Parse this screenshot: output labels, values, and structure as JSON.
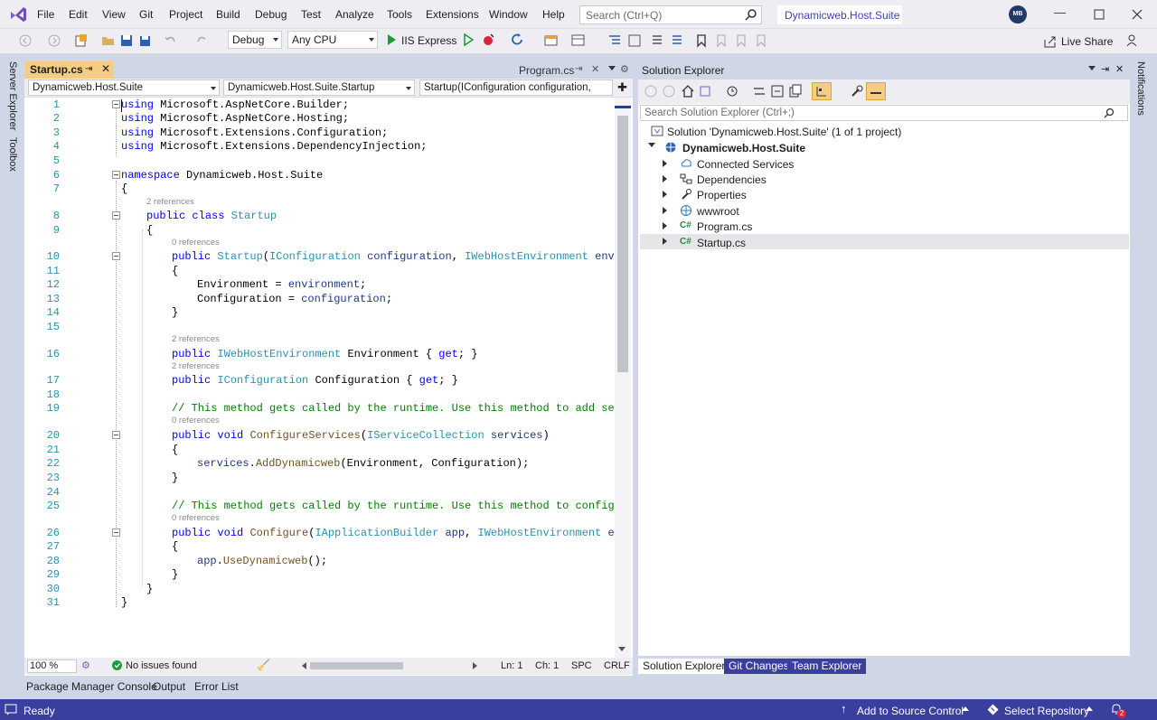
{
  "menu": [
    "File",
    "Edit",
    "View",
    "Git",
    "Project",
    "Build",
    "Debug",
    "Test",
    "Analyze",
    "Tools",
    "Extensions",
    "Window",
    "Help"
  ],
  "search": {
    "placeholder": "Search (Ctrl+Q)"
  },
  "solution_name": "Dynamicweb.Host.Suite",
  "user_initials": "MB",
  "toolbar": {
    "config": "Debug",
    "platform": "Any CPU",
    "run_target": "IIS Express",
    "live_share": "Live Share"
  },
  "side_rails": {
    "server_explorer": "Server Explorer",
    "toolbox": "Toolbox",
    "notifications": "Notifications"
  },
  "editor": {
    "active_tab": "Startup.cs",
    "other_tab": "Program.cs",
    "nav": {
      "project": "Dynamicweb.Host.Suite",
      "type": "Dynamicweb.Host.Suite.Startup",
      "member": "Startup(IConfiguration configuration,"
    },
    "lines": [
      {
        "n": "1",
        "t": "using Microsoft.AspNetCore.Builder;"
      },
      {
        "n": "2",
        "t": "using Microsoft.AspNetCore.Hosting;"
      },
      {
        "n": "3",
        "t": "using Microsoft.Extensions.Configuration;"
      },
      {
        "n": "4",
        "t": "using Microsoft.Extensions.DependencyInjection;"
      },
      {
        "n": "5",
        "t": ""
      },
      {
        "n": "6",
        "t": "namespace Dynamicweb.Host.Suite"
      },
      {
        "n": "7",
        "t": "{"
      },
      {
        "n": "8",
        "t": "public class Startup"
      },
      {
        "n": "9",
        "t": "{"
      },
      {
        "n": "10",
        "t": "public Startup(IConfiguration configuration, IWebHostEnvironment envir"
      },
      {
        "n": "11",
        "t": "{"
      },
      {
        "n": "12",
        "t": "Environment = environment;"
      },
      {
        "n": "13",
        "t": "Configuration = configuration;"
      },
      {
        "n": "14",
        "t": "}"
      },
      {
        "n": "15",
        "t": ""
      },
      {
        "n": "16",
        "t": "public IWebHostEnvironment Environment { get; }"
      },
      {
        "n": "17",
        "t": "public IConfiguration Configuration { get; }"
      },
      {
        "n": "18",
        "t": ""
      },
      {
        "n": "19",
        "t": "// This method gets called by the runtime. Use this method to add serv"
      },
      {
        "n": "20",
        "t": "public void ConfigureServices(IServiceCollection services)"
      },
      {
        "n": "21",
        "t": "{"
      },
      {
        "n": "22",
        "t": "services.AddDynamicweb(Environment, Configuration);"
      },
      {
        "n": "23",
        "t": "}"
      },
      {
        "n": "24",
        "t": ""
      },
      {
        "n": "25",
        "t": "// This method gets called by the runtime. Use this method to configur"
      },
      {
        "n": "26",
        "t": "public void Configure(IApplicationBuilder app, IWebHostEnvironment env"
      },
      {
        "n": "27",
        "t": "{"
      },
      {
        "n": "28",
        "t": "app.UseDynamicweb();"
      },
      {
        "n": "29",
        "t": "}"
      },
      {
        "n": "30",
        "t": "}"
      },
      {
        "n": "31",
        "t": "}"
      }
    ],
    "codelens": {
      "two_refs": "2 references",
      "zero_refs": "0 references"
    },
    "status": {
      "zoom": "100 %",
      "issues": "No issues found",
      "ln": "Ln: 1",
      "ch": "Ch: 1",
      "spc": "SPC",
      "crlf": "CRLF"
    }
  },
  "solution_explorer": {
    "title": "Solution Explorer",
    "search_placeholder": "Search Solution Explorer (Ctrl+;)",
    "solution": "Solution 'Dynamicweb.Host.Suite' (1 of 1 project)",
    "project": "Dynamicweb.Host.Suite",
    "items": [
      "Connected Services",
      "Dependencies",
      "Properties",
      "wwwroot",
      "Program.cs",
      "Startup.cs"
    ],
    "bottom_tabs": [
      "Solution Explorer",
      "Git Changes",
      "Team Explorer"
    ]
  },
  "bottom_tool_tabs": [
    "Package Manager Console",
    "Output",
    "Error List"
  ],
  "status_bar": {
    "ready": "Ready",
    "source_control": "Add to Source Control",
    "repository": "Select Repository",
    "notif_count": "2"
  },
  "colors": {
    "accent": "#3a3f9e",
    "tab_active": "#f5cc84",
    "keyword": "#0000ff",
    "type": "#2b91af",
    "comment": "#008000"
  }
}
